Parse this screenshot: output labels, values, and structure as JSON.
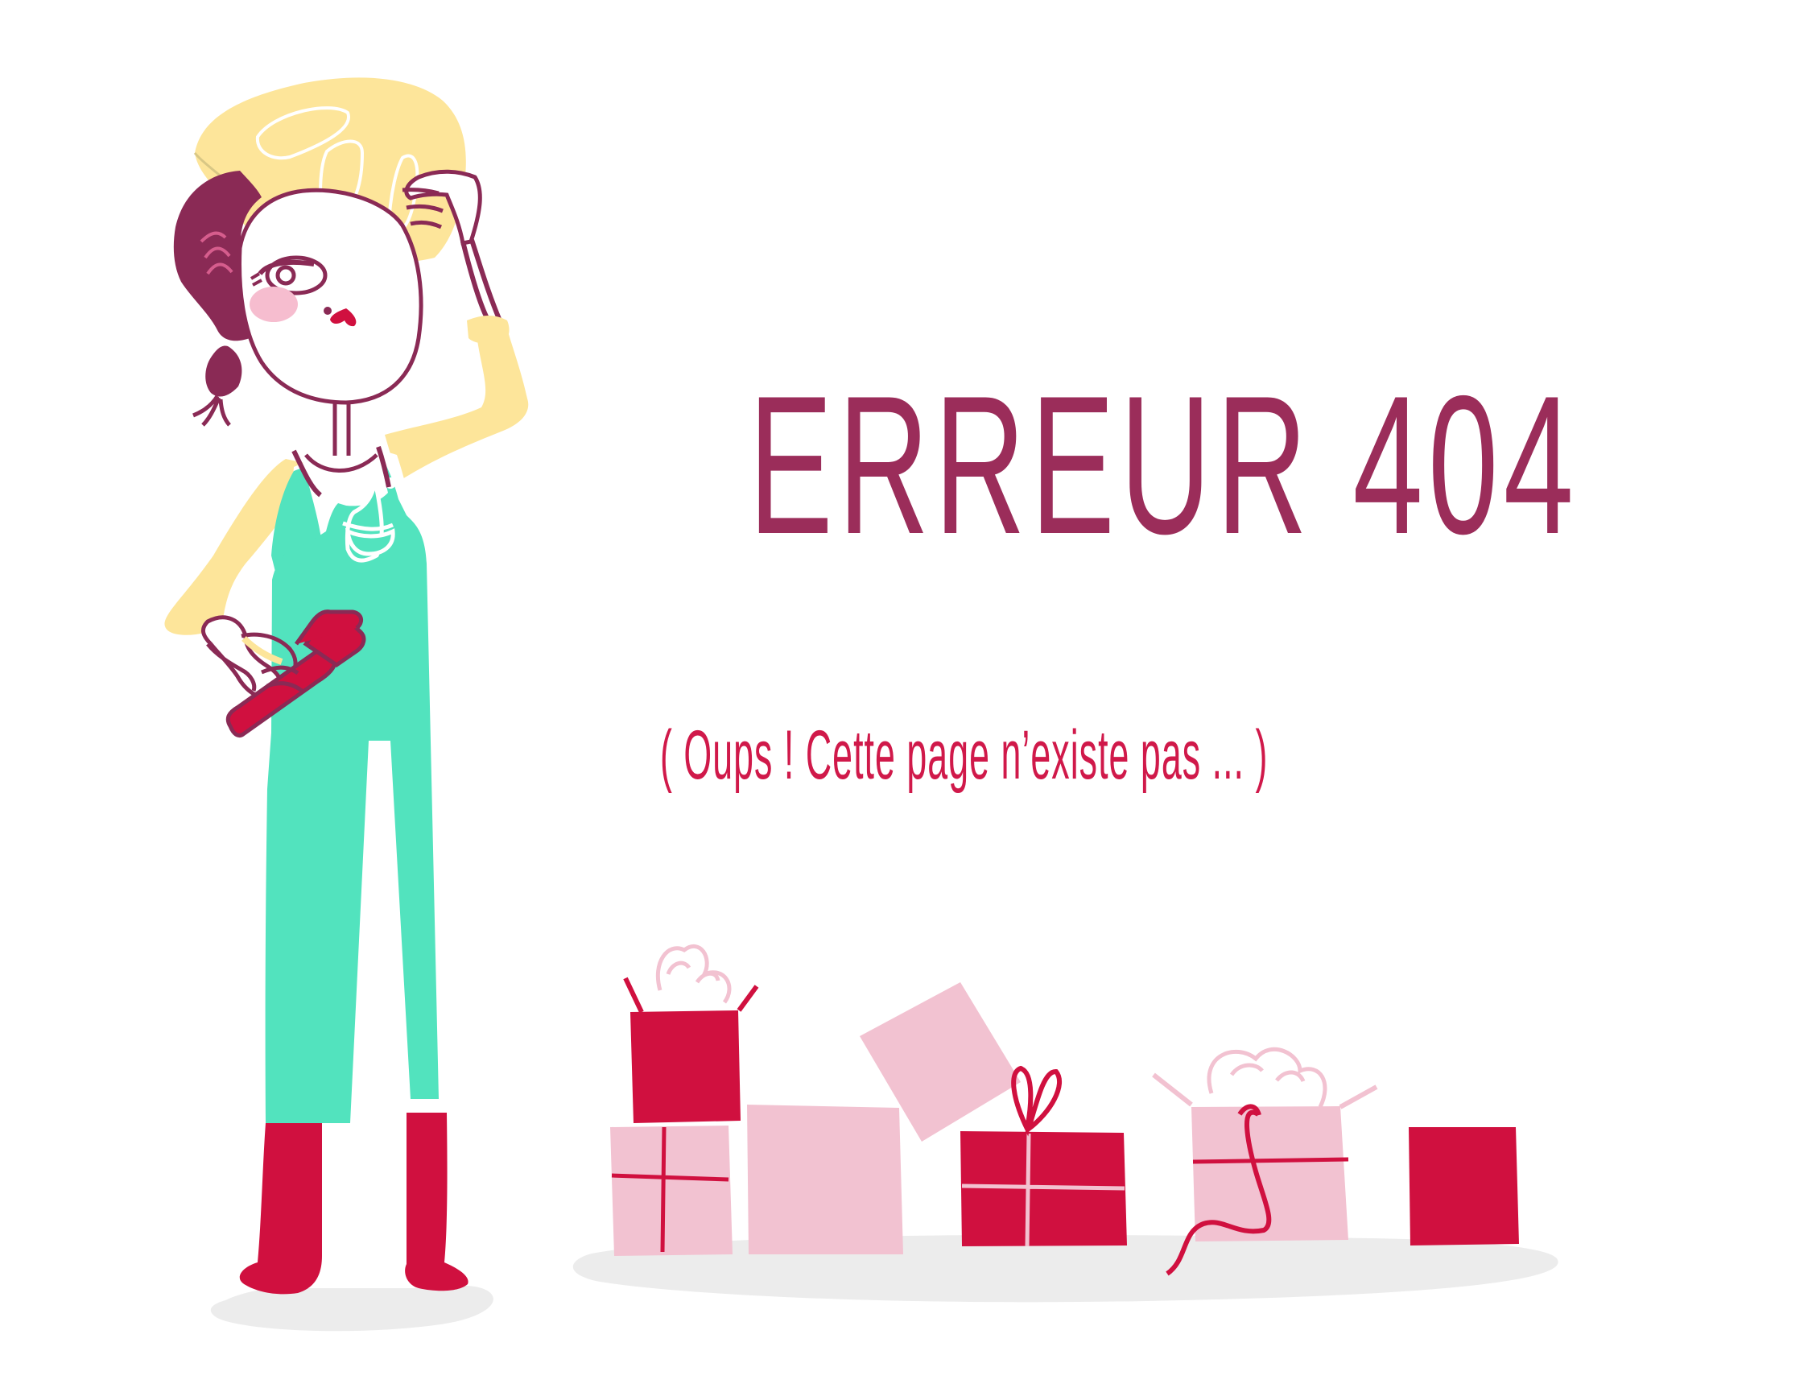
{
  "error": {
    "title": "ERREUR 404",
    "message": "( Oups ! Cette page n’existe pas ... )"
  },
  "colors": {
    "title": "#9b2d5a",
    "message": "#d0194a",
    "overalls": "#52e3be",
    "hat": "#fde59a",
    "skin": "#fde59a",
    "hair": "#8a2a55",
    "boots": "#d0103f",
    "box_red": "#d0103f",
    "box_pink": "#f2c2d1",
    "shadow": "#ebebeb"
  },
  "illustration": {
    "worker": "construction-worker-illustration",
    "tool": "hammer-icon",
    "boxes": "gift-boxes-illustration"
  }
}
